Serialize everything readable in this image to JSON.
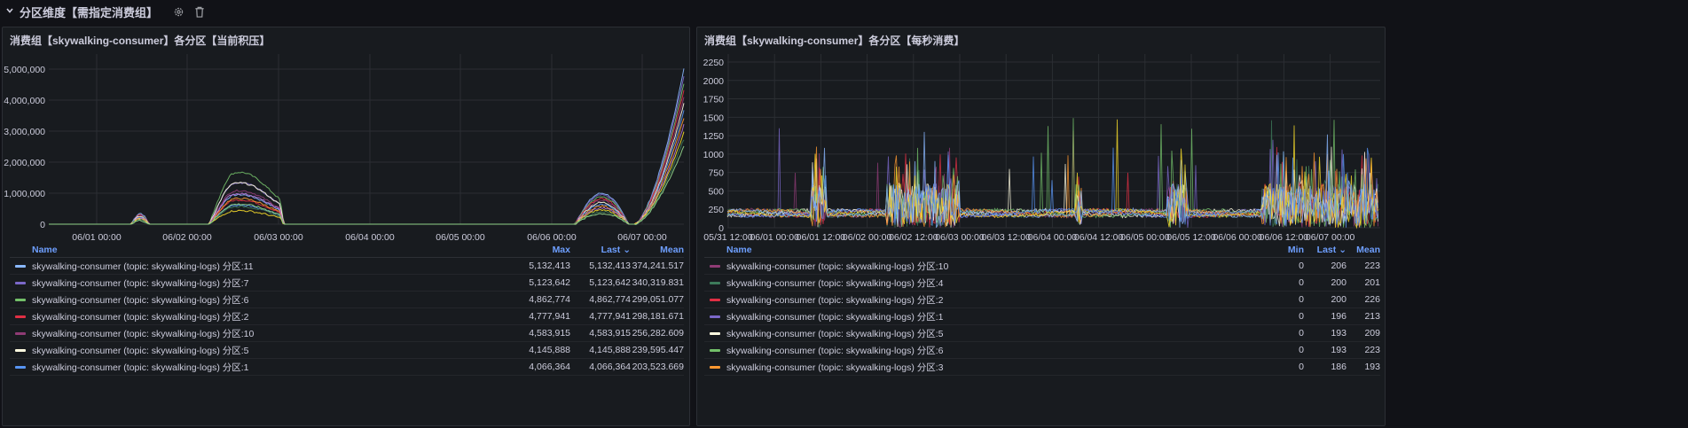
{
  "row": {
    "title": "分区维度【需指定消费组】",
    "icons": [
      "chevron-down-icon",
      "gear-icon",
      "trash-icon"
    ]
  },
  "panels": [
    {
      "title": "消费组【skywalking-consumer】各分区【当前积压】",
      "y_ticks": [
        "5,000,000",
        "4,000,000",
        "3,000,000",
        "2,000,000",
        "1,000,000",
        "0"
      ],
      "x_ticks": [
        "06/01 00:00",
        "06/02 00:00",
        "06/03 00:00",
        "06/04 00:00",
        "06/05 00:00",
        "06/06 00:00",
        "06/07 00:00"
      ],
      "columns": [
        "Name",
        "Max",
        "Last",
        "Mean"
      ],
      "rows": [
        {
          "name": "skywalking-consumer (topic: skywalking-logs) 分区:11",
          "color": "#8ab8ff",
          "values": [
            "5,132,413",
            "5,132,413",
            "374,241.517"
          ]
        },
        {
          "name": "skywalking-consumer (topic: skywalking-logs) 分区:7",
          "color": "#7b68c9",
          "values": [
            "5,123,642",
            "5,123,642",
            "340,319.831"
          ]
        },
        {
          "name": "skywalking-consumer (topic: skywalking-logs) 分区:6",
          "color": "#73bf69",
          "values": [
            "4,862,774",
            "4,862,774",
            "299,051.077"
          ]
        },
        {
          "name": "skywalking-consumer (topic: skywalking-logs) 分区:2",
          "color": "#e02f44",
          "values": [
            "4,777,941",
            "4,777,941",
            "298,181.671"
          ]
        },
        {
          "name": "skywalking-consumer (topic: skywalking-logs) 分区:10",
          "color": "#8f3b75",
          "values": [
            "4,583,915",
            "4,583,915",
            "256,282.609"
          ]
        },
        {
          "name": "skywalking-consumer (topic: skywalking-logs) 分区:5",
          "color": "#fffbe0",
          "values": [
            "4,145,888",
            "4,145,888",
            "239,595.447"
          ]
        },
        {
          "name": "skywalking-consumer (topic: skywalking-logs) 分区:1",
          "color": "#5794f2",
          "values": [
            "4,066,364",
            "4,066,364",
            "203,523.669"
          ]
        }
      ]
    },
    {
      "title": "消费组【skywalking-consumer】各分区【每秒消费】",
      "y_ticks": [
        "2250",
        "2000",
        "1750",
        "1500",
        "1250",
        "1000",
        "750",
        "500",
        "250",
        "0"
      ],
      "x_ticks": [
        "05/31 12:00",
        "06/01 00:00",
        "06/01 12:00",
        "06/02 00:00",
        "06/02 12:00",
        "06/03 00:00",
        "06/03 12:00",
        "06/04 00:00",
        "06/04 12:00",
        "06/05 00:00",
        "06/05 12:00",
        "06/06 00:00",
        "06/06 12:00",
        "06/07 00:00"
      ],
      "columns": [
        "Name",
        "Min",
        "Last",
        "Mean"
      ],
      "rows": [
        {
          "name": "skywalking-consumer (topic: skywalking-logs) 分区:10",
          "color": "#8f3b75",
          "values": [
            "0",
            "206",
            "223"
          ]
        },
        {
          "name": "skywalking-consumer (topic: skywalking-logs) 分区:4",
          "color": "#3d7a5a",
          "values": [
            "0",
            "200",
            "201"
          ]
        },
        {
          "name": "skywalking-consumer (topic: skywalking-logs) 分区:2",
          "color": "#e02f44",
          "values": [
            "0",
            "200",
            "226"
          ]
        },
        {
          "name": "skywalking-consumer (topic: skywalking-logs) 分区:1",
          "color": "#7b68c9",
          "values": [
            "0",
            "196",
            "213"
          ]
        },
        {
          "name": "skywalking-consumer (topic: skywalking-logs) 分区:5",
          "color": "#fffbe0",
          "values": [
            "0",
            "193",
            "209"
          ]
        },
        {
          "name": "skywalking-consumer (topic: skywalking-logs) 分区:6",
          "color": "#73bf69",
          "values": [
            "0",
            "193",
            "223"
          ]
        },
        {
          "name": "skywalking-consumer (topic: skywalking-logs) 分区:3",
          "color": "#ff9830",
          "values": [
            "0",
            "186",
            "193"
          ]
        }
      ]
    }
  ],
  "sort_indicator": "⌄"
}
